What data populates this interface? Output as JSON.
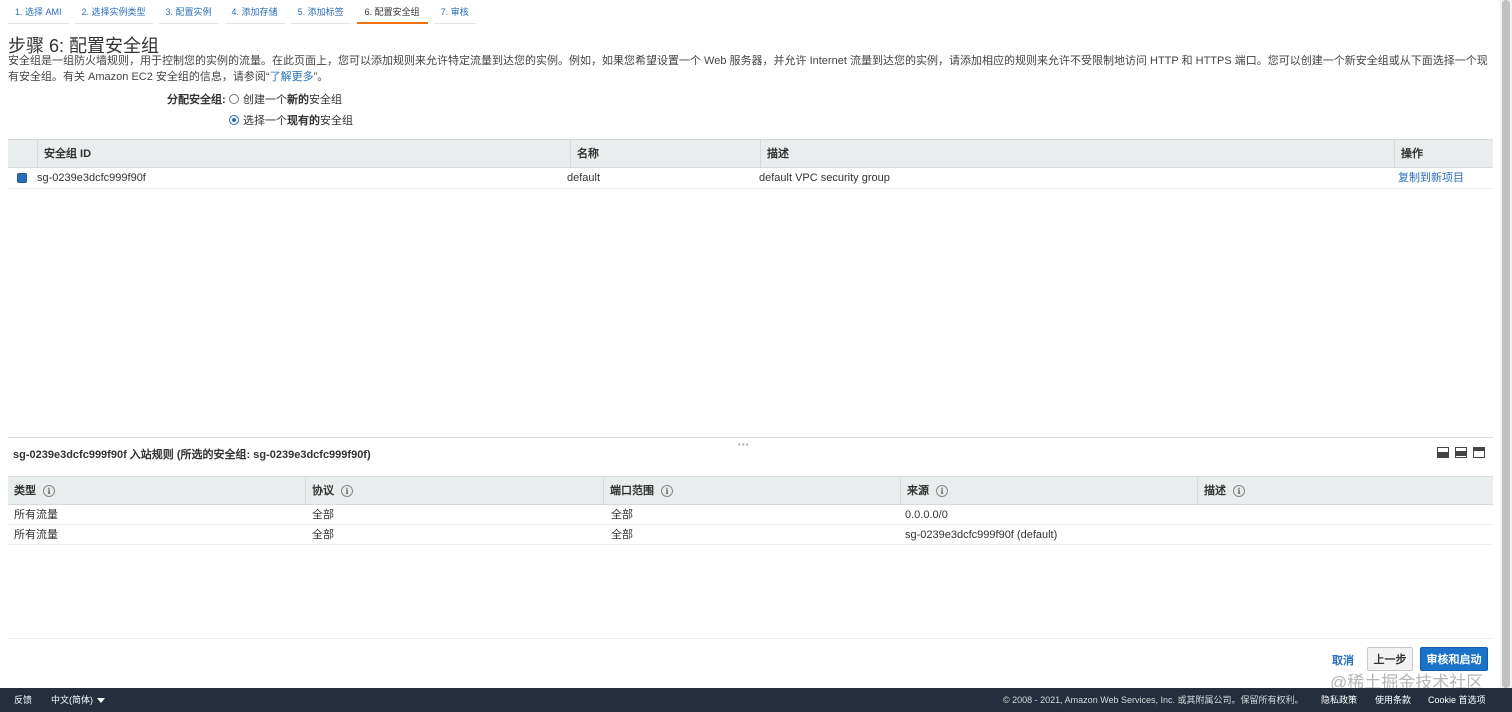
{
  "wizard": {
    "steps": [
      {
        "label": "1. 选择 AMI"
      },
      {
        "label": "2. 选择实例类型"
      },
      {
        "label": "3. 配置实例"
      },
      {
        "label": "4. 添加存储"
      },
      {
        "label": "5. 添加标签"
      },
      {
        "label": "6. 配置安全组"
      },
      {
        "label": "7. 审核"
      }
    ],
    "active_step": 6
  },
  "page": {
    "title": "步骤 6: 配置安全组",
    "description": "安全组是一组防火墙规则，用于控制您的实例的流量。在此页面上，您可以添加规则来允许特定流量到达您的实例。例如，如果您希望设置一个 Web 服务器，并允许 Internet 流量到达您的实例，请添加相应的规则来允许不受限制地访问 HTTP 和 HTTPS 端口。您可以创建一个新安全组或从下面选择一个现有安全组。有关 Amazon EC2 安全组的信息，请参阅“",
    "learn_more": "了解更多",
    "description_end": "”。"
  },
  "assign": {
    "label": "分配安全组:",
    "option_new_prefix": "创建一个",
    "option_new_bold": "新的",
    "option_new_suffix": "安全组",
    "option_existing_prefix": "选择一个",
    "option_existing_bold": "现有的",
    "option_existing_suffix": "安全组",
    "selected": "existing"
  },
  "sg_table": {
    "headers": {
      "id": "安全组 ID",
      "name": "名称",
      "description": "描述",
      "actions": "操作"
    },
    "rows": [
      {
        "id": "sg-0239e3dcfc999f90f",
        "name": "default",
        "description": "default VPC security group",
        "action": "复制到新项目",
        "checked": true
      }
    ]
  },
  "rules": {
    "title": "sg-0239e3dcfc999f90f 入站规则 (所选的安全组: sg-0239e3dcfc999f90f)",
    "headers": {
      "type": "类型",
      "protocol": "协议",
      "port_range": "端口范围",
      "source": "来源",
      "description": "描述"
    },
    "rows": [
      {
        "type": "所有流量",
        "protocol": "全部",
        "port_range": "全部",
        "source": "0.0.0.0/0",
        "description": ""
      },
      {
        "type": "所有流量",
        "protocol": "全部",
        "port_range": "全部",
        "source": "sg-0239e3dcfc999f90f (default)",
        "description": ""
      }
    ]
  },
  "actions": {
    "cancel": "取消",
    "previous": "上一步",
    "review_launch": "审核和启动"
  },
  "bottombar": {
    "feedback": "反馈",
    "language": "中文(简体)",
    "copyright": "© 2008 - 2021, Amazon Web Services, Inc. 或其附属公司。保留所有权利。",
    "privacy": "隐私政策",
    "terms": "使用条款",
    "cookie": "Cookie 首选项"
  },
  "watermark": "@稀土掘金技术社区",
  "colors": {
    "accent": "#ec7211",
    "link": "#2a6ebb",
    "primary_button": "#1a73c9",
    "footer": "#232f3e"
  }
}
